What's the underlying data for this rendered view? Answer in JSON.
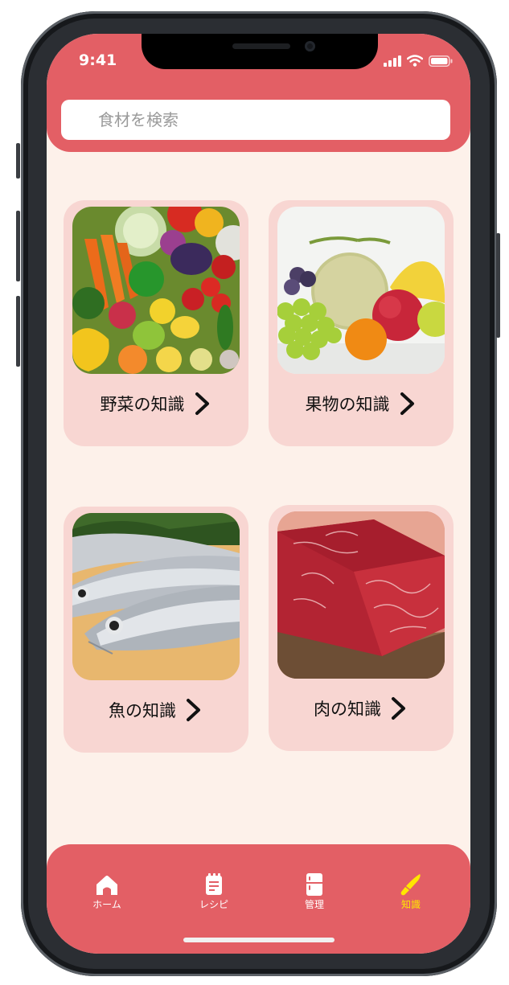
{
  "status": {
    "time": "9:41"
  },
  "search": {
    "placeholder": "食材を検索"
  },
  "cards": [
    {
      "label": "野菜の知識"
    },
    {
      "label": "果物の知識"
    },
    {
      "label": "魚の知識"
    },
    {
      "label": "肉の知識"
    }
  ],
  "tabs": [
    {
      "label": "ホーム",
      "icon": "home-icon"
    },
    {
      "label": "レシピ",
      "icon": "recipe-icon"
    },
    {
      "label": "管理",
      "icon": "fridge-icon"
    },
    {
      "label": "知識",
      "icon": "knife-icon"
    }
  ],
  "colors": {
    "brand": "#e35f65",
    "background": "#fdf1ea",
    "card": "#f8d6d2",
    "active_tab": "#ffe600"
  }
}
